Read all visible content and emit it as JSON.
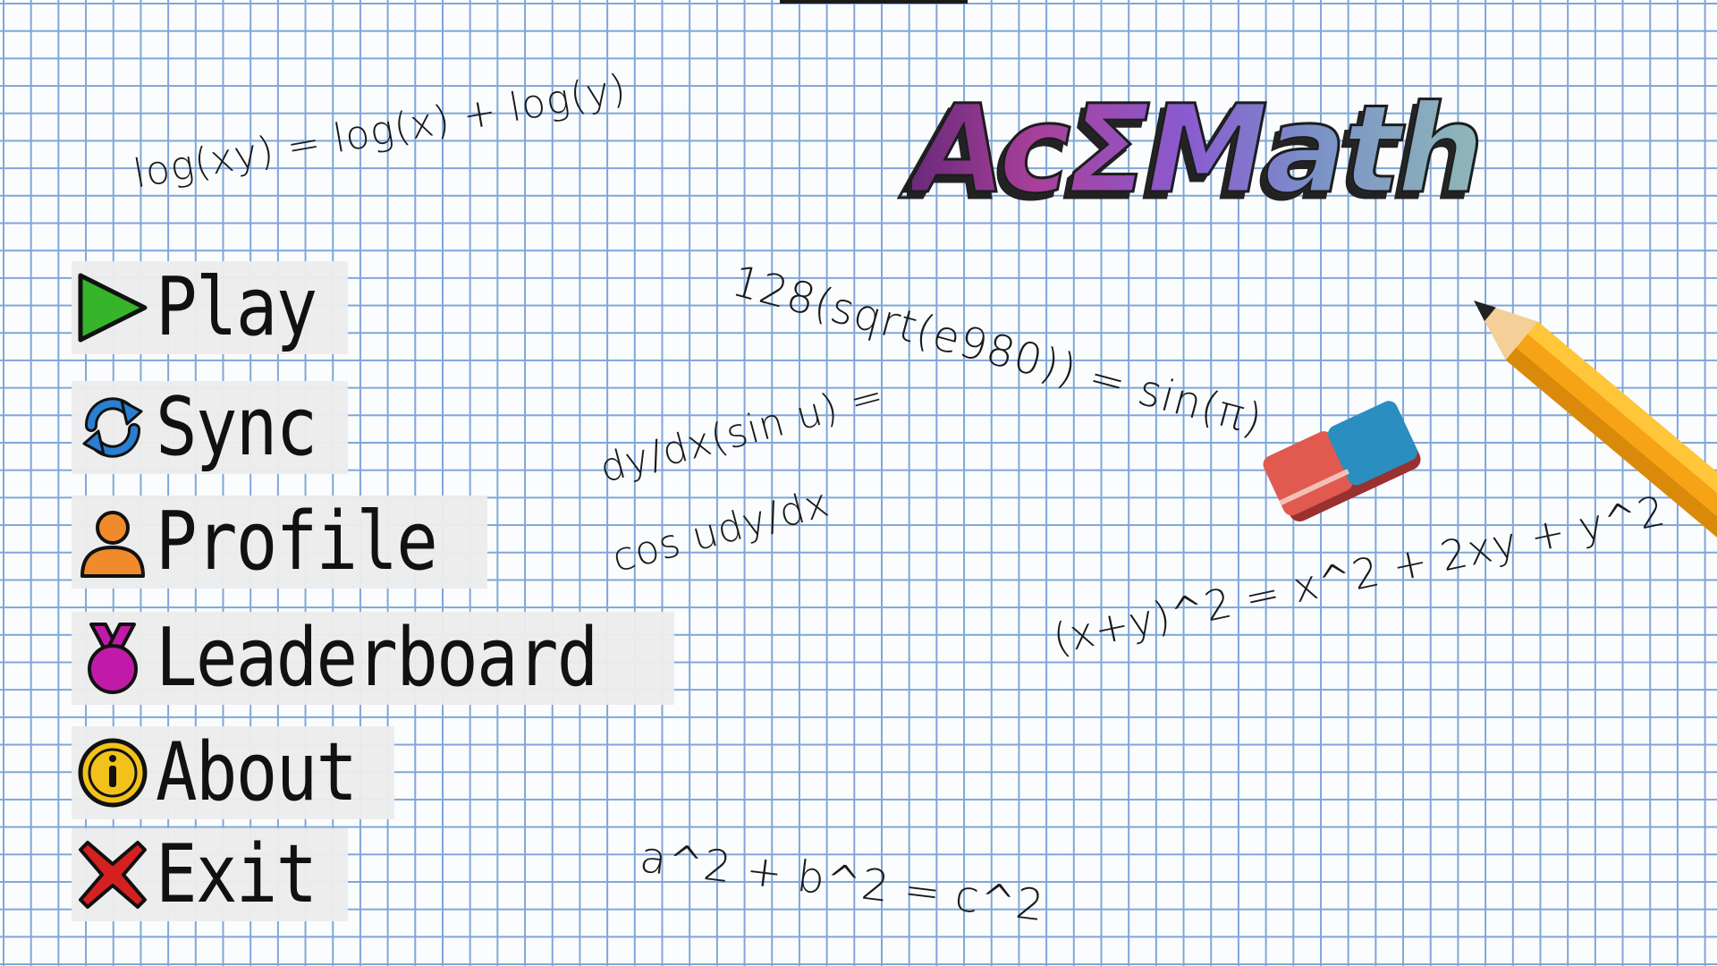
{
  "title": "AcΣMath",
  "menu": [
    {
      "id": "play",
      "label": "Play",
      "icon": "play-icon",
      "color": "#36b52a"
    },
    {
      "id": "sync",
      "label": "Sync",
      "icon": "sync-icon",
      "color": "#2a7fd0"
    },
    {
      "id": "profile",
      "label": "Profile",
      "icon": "profile-icon",
      "color": "#f08a2a"
    },
    {
      "id": "leaderboard",
      "label": "Leaderboard",
      "icon": "medal-icon",
      "color": "#c21aa8"
    },
    {
      "id": "about",
      "label": "About",
      "icon": "info-icon",
      "color": "#f2c21a"
    },
    {
      "id": "exit",
      "label": "Exit",
      "icon": "exit-icon",
      "color": "#d42020"
    }
  ],
  "equations": {
    "log": "log(xy) = log(x) + log(y)",
    "sqrt": "128(sqrt(e980)) = sin(π)",
    "deriv_line1": "dy/dx(sin u) =",
    "deriv_line2": "cos udy/dx",
    "binomial": "(x+y)^2 = x^2 + 2xy + y^2",
    "pythag": "a^2 + b^2 = c^2"
  },
  "colors": {
    "grid": "#7da7d8",
    "paper": "#fbfcfe",
    "title_gradient": [
      "#6a2a7a",
      "#a8409a",
      "#8a5ad0",
      "#7a90c8",
      "#8fb8b8"
    ]
  }
}
